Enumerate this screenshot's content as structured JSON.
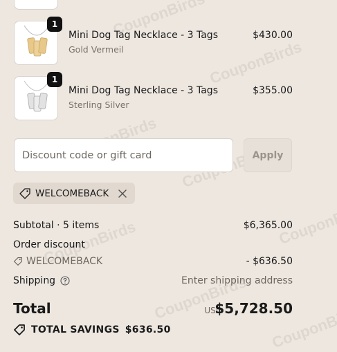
{
  "watermark": "CouponBirds",
  "items": [
    {
      "name": "Mini Dog Tag Necklace - 3 Tags",
      "variant": "Gold Vermeil",
      "price": "$430.00",
      "qty": "1",
      "color": "#e8c98a"
    },
    {
      "name": "Mini Dog Tag Necklace - 3 Tags",
      "variant": "Sterling Silver",
      "price": "$355.00",
      "qty": "1",
      "color": "#d4d4d4"
    }
  ],
  "discount": {
    "placeholder": "Discount code or gift card",
    "apply_label": "Apply"
  },
  "applied_code": "WELCOMEBACK",
  "summary": {
    "subtotal_label": "Subtotal · 5 items",
    "subtotal_value": "$6,365.00",
    "order_discount_label": "Order discount",
    "discount_code": "WELCOMEBACK",
    "discount_value": "- $636.50",
    "shipping_label": "Shipping",
    "shipping_value": "Enter shipping address",
    "total_label": "Total",
    "currency": "USD",
    "total_value": "$5,728.50",
    "savings_label": "TOTAL SAVINGS",
    "savings_value": "$636.50"
  }
}
